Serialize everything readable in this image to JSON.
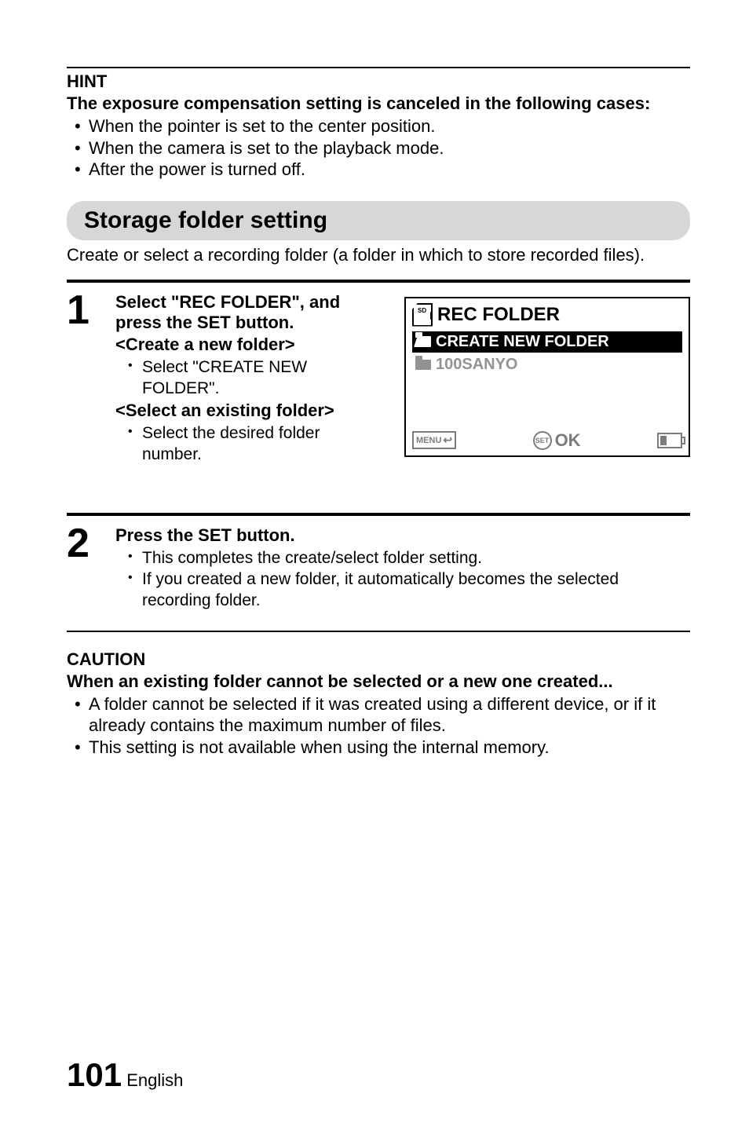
{
  "hint": {
    "label": "HINT",
    "title": "The exposure compensation setting is canceled in the following cases:",
    "bullets": [
      "When the pointer is set to the center position.",
      "When the camera is set to the playback mode.",
      "After the power is turned off."
    ]
  },
  "section": {
    "heading": "Storage folder setting",
    "lead": "Create or select a recording folder (a folder in which to store recorded files)."
  },
  "step1": {
    "num": "1",
    "line1": "Select \"REC FOLDER\", and press the SET button.",
    "sub1_title": "<Create a new folder>",
    "sub1_bullet": "Select \"CREATE NEW FOLDER\".",
    "sub2_title": "<Select an existing folder>",
    "sub2_bullet": "Select the desired folder number."
  },
  "screen": {
    "title": "REC FOLDER",
    "row_selected": "CREATE NEW FOLDER",
    "row_sub": "100SANYO",
    "menu_label": "MENU",
    "set_label": "SET",
    "ok_label": "OK"
  },
  "step2": {
    "num": "2",
    "line1": "Press the SET button.",
    "bullets": [
      "This completes the create/select folder setting.",
      "If you created a new folder, it automatically becomes the selected recording folder."
    ]
  },
  "caution": {
    "label": "CAUTION",
    "title": "When an existing folder cannot be selected or a new one created...",
    "bullets": [
      "A folder cannot be selected if it was created using a different device, or if it already contains the maximum number of files.",
      "This setting is not available when using the internal memory."
    ]
  },
  "footer": {
    "page": "101",
    "lang": "English"
  }
}
